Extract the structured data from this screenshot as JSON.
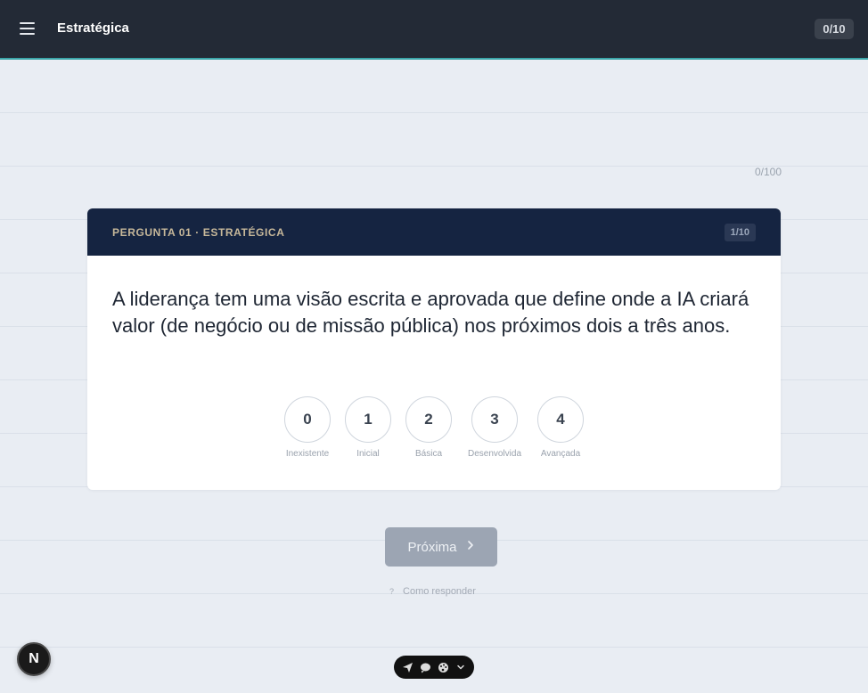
{
  "header": {
    "title": "Estratégica",
    "progress": "0/10"
  },
  "score": "0/100",
  "card": {
    "label": "PERGUNTA 01 · ESTRATÉGICA",
    "count": "1/10",
    "question": "A liderança tem uma visão escrita e aprovada que define onde a IA criará valor (de negócio ou de missão pública) nos próximos dois a três anos.",
    "options": [
      {
        "value": "0",
        "label": "Inexistente"
      },
      {
        "value": "1",
        "label": "Inicial"
      },
      {
        "value": "2",
        "label": "Básica"
      },
      {
        "value": "3",
        "label": "Desenvolvida"
      },
      {
        "value": "4",
        "label": "Avançada"
      }
    ]
  },
  "next_button": {
    "label": "Próxima",
    "icon": "chevron-right-icon"
  },
  "howto": {
    "label": "Como responder",
    "icon": "?"
  },
  "avatar": "N",
  "toolbar_icons": [
    "send-icon",
    "chat-icon",
    "palette-icon",
    "chevron-down-icon"
  ],
  "colors": {
    "header_bg": "#232a36",
    "accent": "#3aa5a9",
    "card_head_bg": "#152441",
    "card_head_label": "#c7b89a",
    "button_disabled": "#9ca5b3"
  }
}
